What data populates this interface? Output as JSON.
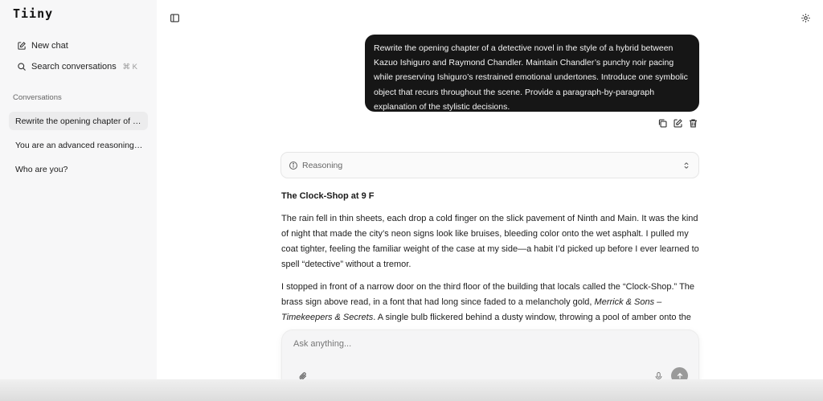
{
  "app": {
    "logo": "Tiiny"
  },
  "sidebar": {
    "new_chat": "New chat",
    "search": "Search conversations",
    "search_shortcut": "⌘ K",
    "section_label": "Conversations",
    "conversations": [
      {
        "title": "Rewrite the opening chapter of a ...",
        "active": true
      },
      {
        "title": "You are an advanced reasoning s...",
        "active": false
      },
      {
        "title": "Who are you?",
        "active": false
      }
    ]
  },
  "chat": {
    "user_message": "Rewrite the opening chapter of a detective novel in the style of a hybrid between Kazuo Ishiguro and Raymond Chandler. Maintain Chandler’s punchy noir pacing while preserving Ishiguro’s restrained emotional undertones. Introduce one symbolic object that recurs throughout the scene. Provide a paragraph-by-paragraph explanation of the stylistic decisions.",
    "reasoning_label": "Reasoning",
    "answer": {
      "heading": "The Clock‑Shop at 9 F",
      "paragraph1": "The rain fell in thin sheets, each drop a cold finger on the slick pavement of Ninth and Main. It was the kind of night that made the city’s neon signs look like bruises, bleeding color onto the wet asphalt. I pulled my coat tighter, feeling the familiar weight of the case at my side—a habit I’d picked up before I ever learned to spell “detective” without a tremor.",
      "paragraph2_start": "I stopped in front of a narrow door on the third floor of the building that locals called the “Clock‑Shop.” The brass sign above read, in a font that had long since faded to a melancholy gold, ",
      "paragraph2_em": "Merrick & Sons – Timekeepers & Secrets",
      "paragraph2_end": ". A single bulb flickered behind a dusty window, throwing a pool of amber onto the"
    }
  },
  "composer": {
    "placeholder": "Ask anything..."
  },
  "colors": {
    "bubble": "#161616",
    "sidebar": "#f7f7f8",
    "send_button": "#9a9a9a"
  },
  "icons": {
    "new_chat": "edit-icon",
    "search": "search-icon",
    "sidebar_toggle": "sidebar-toggle-icon",
    "settings": "gear-icon",
    "copy": "copy-icon",
    "edit": "edit-icon",
    "delete": "trash-icon",
    "reasoning": "info-icon",
    "expand": "chevron-updown-icon",
    "attach": "paperclip-icon",
    "mic": "microphone-icon",
    "send": "arrow-up-icon"
  }
}
